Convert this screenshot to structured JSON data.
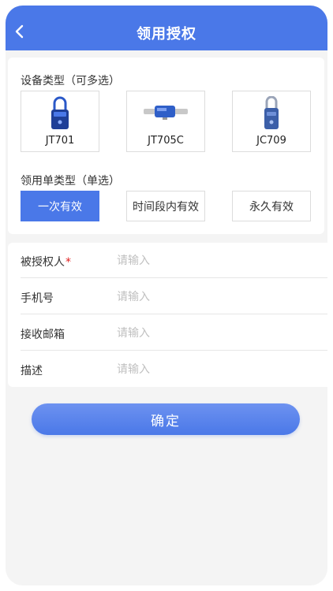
{
  "header": {
    "title": "领用授权",
    "back_icon": "chevron-left-icon"
  },
  "colors": {
    "primary": "#4a78e8",
    "background": "#f4f4f4",
    "required": "#e02020",
    "placeholder": "#c0c0c0"
  },
  "device_section": {
    "label": "设备类型（可多选）",
    "devices": [
      {
        "name": "JT701",
        "icon": "padlock-device-icon"
      },
      {
        "name": "JT705C",
        "icon": "cable-lock-device-icon"
      },
      {
        "name": "JC709",
        "icon": "shackle-lock-device-icon"
      }
    ]
  },
  "order_type_section": {
    "label": "领用单类型（单选）",
    "options": [
      {
        "label": "一次有效",
        "selected": true
      },
      {
        "label": "时间段内有效",
        "selected": false
      },
      {
        "label": "永久有效",
        "selected": false
      }
    ]
  },
  "form": {
    "fields": [
      {
        "label": "被授权人",
        "required_mark": "*",
        "placeholder": "请输入",
        "value": ""
      },
      {
        "label": "手机号",
        "placeholder": "请输入",
        "value": ""
      },
      {
        "label": "接收邮箱",
        "placeholder": "请输入",
        "value": ""
      },
      {
        "label": "描述",
        "placeholder": "请输入",
        "value": ""
      }
    ]
  },
  "submit": {
    "label": "确定"
  }
}
